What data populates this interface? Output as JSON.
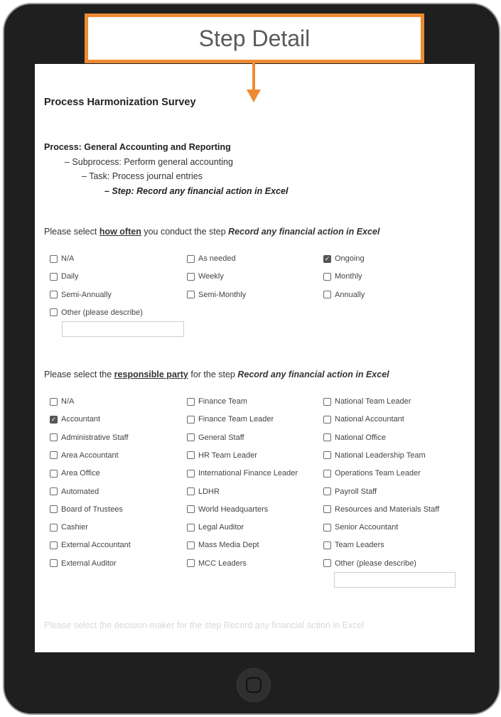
{
  "callout": {
    "title": "Step Detail"
  },
  "survey": {
    "title": "Process Harmonization Survey",
    "hierarchy": {
      "process": "Process: General Accounting and Reporting",
      "subprocess": "– Subprocess: Perform general accounting",
      "task": "– Task: Process journal entries",
      "step": "– Step: Record any financial action in Excel"
    },
    "frequency": {
      "q_prefix": "Please select ",
      "q_emphasis": "how often",
      "q_middle": " you conduct the step ",
      "q_step": "Record any financial action in Excel",
      "options": [
        {
          "label": "N/A",
          "checked": false
        },
        {
          "label": "As needed",
          "checked": false
        },
        {
          "label": "Ongoing",
          "checked": true
        },
        {
          "label": "Daily",
          "checked": false
        },
        {
          "label": "Weekly",
          "checked": false
        },
        {
          "label": "Monthly",
          "checked": false
        },
        {
          "label": "Semi-Annually",
          "checked": false
        },
        {
          "label": "Semi-Monthly",
          "checked": false
        },
        {
          "label": "Annually",
          "checked": false
        },
        {
          "label": "Other (please describe)",
          "checked": false
        }
      ]
    },
    "responsible": {
      "q_prefix": "Please select the ",
      "q_emphasis": "responsible party",
      "q_middle": " for the step ",
      "q_step": "Record any financial action in Excel",
      "options": [
        {
          "label": "N/A",
          "checked": false
        },
        {
          "label": "Finance Team",
          "checked": false
        },
        {
          "label": "National Team Leader",
          "checked": false
        },
        {
          "label": "Accountant",
          "checked": true
        },
        {
          "label": "Finance Team Leader",
          "checked": false
        },
        {
          "label": "National Accountant",
          "checked": false
        },
        {
          "label": "Administrative Staff",
          "checked": false
        },
        {
          "label": "General Staff",
          "checked": false
        },
        {
          "label": "National Office",
          "checked": false
        },
        {
          "label": "Area Accountant",
          "checked": false
        },
        {
          "label": "HR Team Leader",
          "checked": false
        },
        {
          "label": "National Leadership Team",
          "checked": false
        },
        {
          "label": "Area Office",
          "checked": false
        },
        {
          "label": "International Finance Leader",
          "checked": false
        },
        {
          "label": "Operations Team Leader",
          "checked": false
        },
        {
          "label": "Automated",
          "checked": false
        },
        {
          "label": "LDHR",
          "checked": false
        },
        {
          "label": "Payroll Staff",
          "checked": false
        },
        {
          "label": "Board of Trustees",
          "checked": false
        },
        {
          "label": "World Headquarters",
          "checked": false
        },
        {
          "label": "Resources and Materials Staff",
          "checked": false
        },
        {
          "label": "Cashier",
          "checked": false
        },
        {
          "label": "Legal Auditor",
          "checked": false
        },
        {
          "label": "Senior Accountant",
          "checked": false
        },
        {
          "label": "External Accountant",
          "checked": false
        },
        {
          "label": "Mass Media Dept",
          "checked": false
        },
        {
          "label": "Team Leaders",
          "checked": false
        },
        {
          "label": "External Auditor",
          "checked": false
        },
        {
          "label": "MCC Leaders",
          "checked": false
        },
        {
          "label": "Other (please describe)",
          "checked": false
        }
      ]
    },
    "next_question_partial": "Please select the decision-maker for the step Record any financial action in Excel"
  },
  "colors": {
    "accent": "#ee8a33",
    "frame": "#1f1f1f"
  }
}
